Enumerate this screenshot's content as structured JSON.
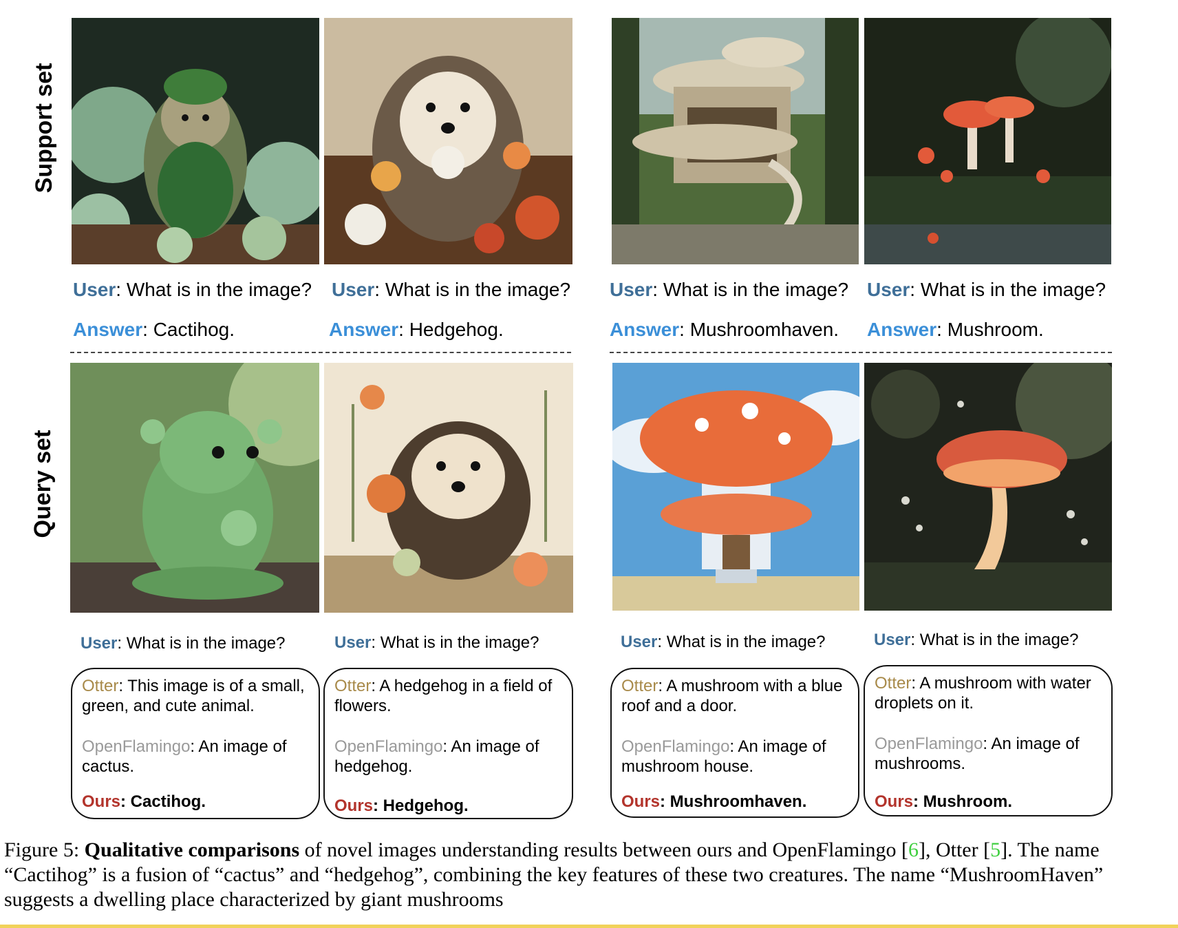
{
  "row_labels": {
    "support": "Support set",
    "query": "Query set"
  },
  "support": [
    {
      "user_label": "User",
      "question": ": What is in the image?",
      "answer_label": "Answer",
      "answer": ": Cactihog."
    },
    {
      "user_label": "User",
      "question": ": What is in the image?",
      "answer_label": "Answer",
      "answer": ": Hedgehog."
    },
    {
      "user_label": "User",
      "question": ": What is in the image?",
      "answer_label": "Answer",
      "answer": ": Mushroomhaven."
    },
    {
      "user_label": "User",
      "question": ": What is in the image?",
      "answer_label": "Answer",
      "answer": ": Mushroom."
    }
  ],
  "query": [
    {
      "user_label": "User",
      "question": ": What is in the image?",
      "otter_label": "Otter",
      "otter": ":  This image is of a small, green, and cute animal.",
      "flamingo_label": "OpenFlamingo",
      "flamingo": ":  An image of cactus.",
      "ours_label": "Ours",
      "ours": ": Cactihog."
    },
    {
      "user_label": "User",
      "question": ": What is in the image?",
      "otter_label": "Otter",
      "otter": ": A hedgehog in a field of flowers.",
      "flamingo_label": "OpenFlamingo",
      "flamingo": ": An image of hedgehog.",
      "ours_label": "Ours",
      "ours": ": Hedgehog."
    },
    {
      "user_label": "User",
      "question": ": What is in the image?",
      "otter_label": "Otter",
      "otter": ":  A mushroom with a blue roof and a door.",
      "flamingo_label": "OpenFlamingo",
      "flamingo": ":  An image of mushroom house.",
      "ours_label": "Ours",
      "ours": ": Mushroomhaven."
    },
    {
      "user_label": "User",
      "question": ": What is in the image?",
      "otter_label": "Otter",
      "otter": ": A mushroom with water droplets on it.",
      "flamingo_label": "OpenFlamingo",
      "flamingo": ": An image of mushrooms.",
      "ours_label": "Ours",
      "ours": ": Mushroom."
    }
  ],
  "caption": {
    "prefix": "Figure 5: ",
    "bold": "Qualitative comparisons",
    "text1": " of novel images understanding results between ours and OpenFlamingo [",
    "ref1": "6",
    "text2": "], Otter [",
    "ref2": "5",
    "text3": "]. The name “Cactihog” is a fusion of “cactus” and “hedgehog”, combining the key features of these two creatures. The name “MushroomHaven” suggests a dwelling place characterized by giant mushrooms"
  },
  "colors": {
    "user": "#3f6f98",
    "answer": "#3b8fd8",
    "otter": "#a88a4a",
    "openflamingo": "#9a9a9a",
    "ours": "#b3342c",
    "reference": "#3fcf3f"
  }
}
